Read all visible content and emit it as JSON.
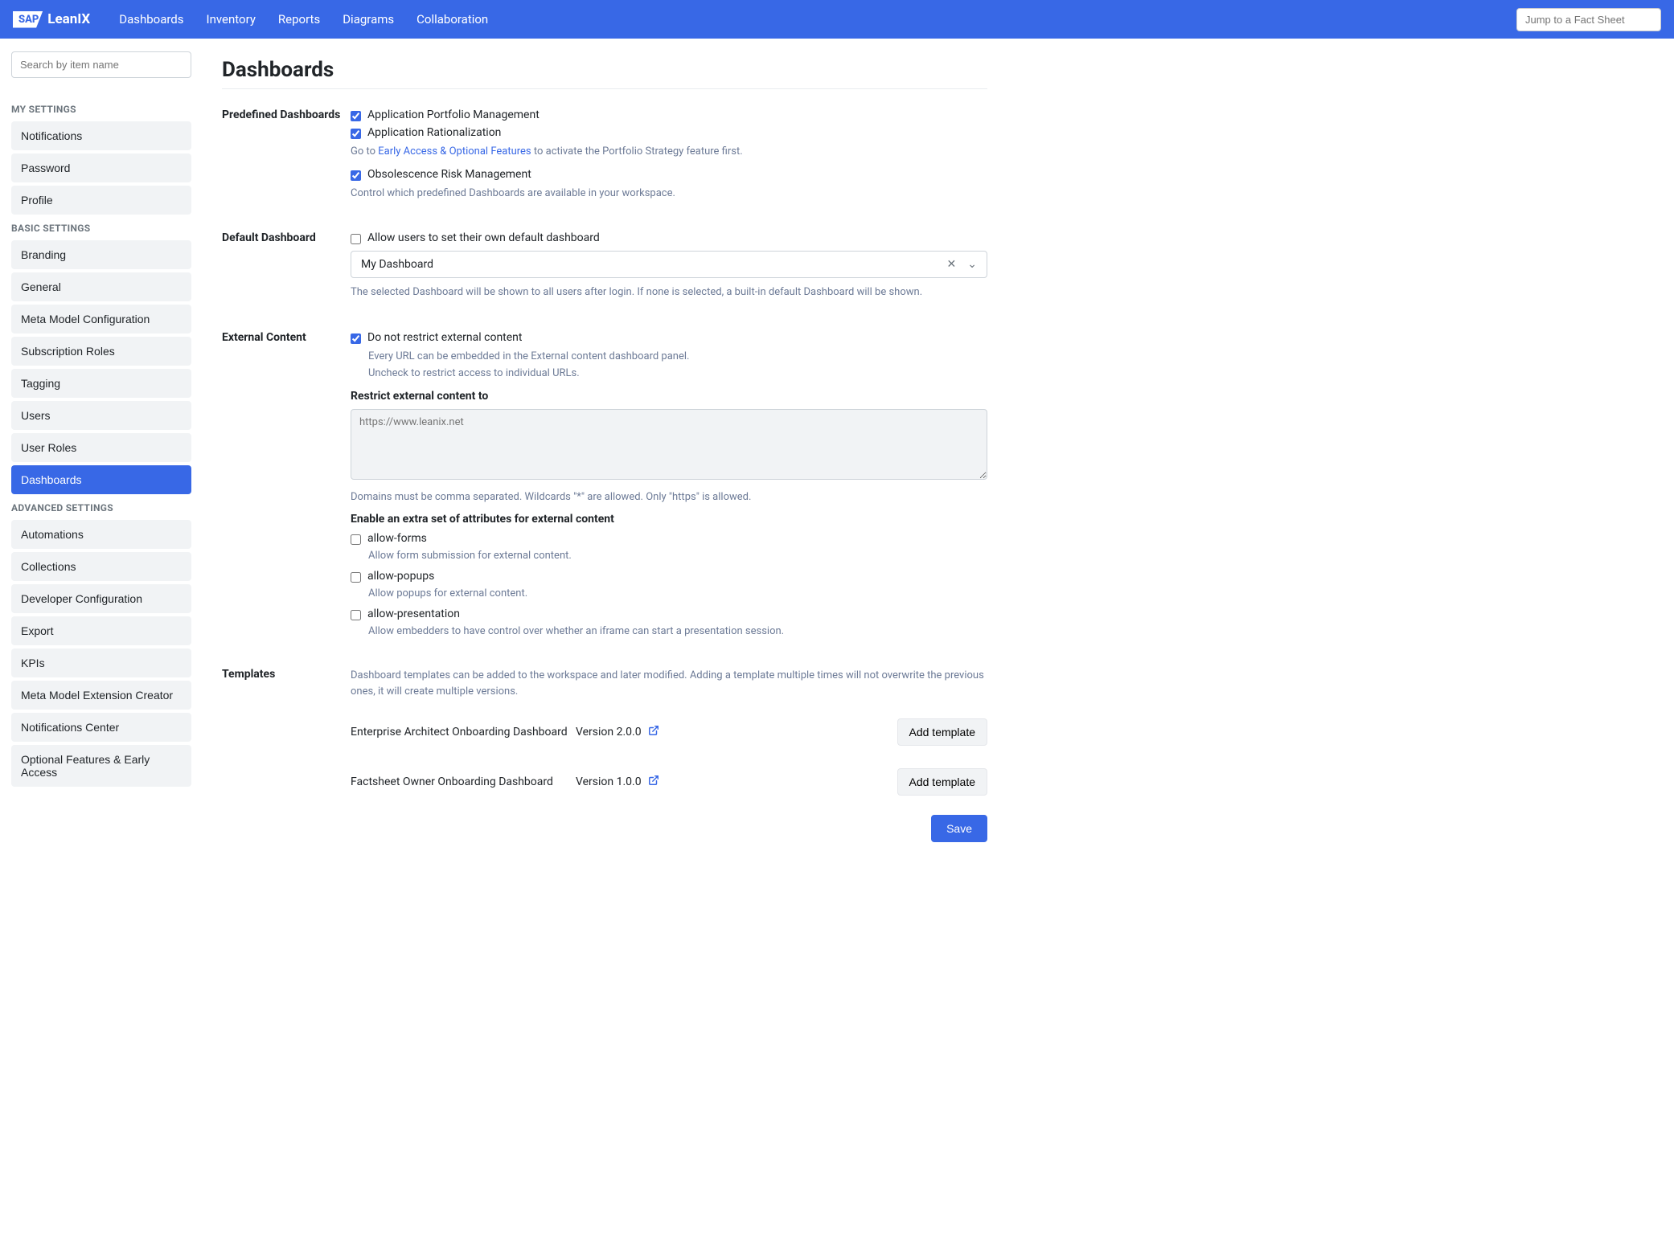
{
  "topnav": {
    "brand_sap": "SAP",
    "brand_product": "LeanIX",
    "links": [
      "Dashboards",
      "Inventory",
      "Reports",
      "Diagrams",
      "Collaboration"
    ],
    "jump_placeholder": "Jump to a Fact Sheet"
  },
  "sidebar": {
    "search_placeholder": "Search by item name",
    "groups": [
      {
        "heading": "MY SETTINGS",
        "items": [
          "Notifications",
          "Password",
          "Profile"
        ]
      },
      {
        "heading": "BASIC SETTINGS",
        "items": [
          "Branding",
          "General",
          "Meta Model Configuration",
          "Subscription Roles",
          "Tagging",
          "Users",
          "User Roles",
          "Dashboards"
        ]
      },
      {
        "heading": "ADVANCED SETTINGS",
        "items": [
          "Automations",
          "Collections",
          "Developer Configuration",
          "Export",
          "KPIs",
          "Meta Model Extension Creator",
          "Notifications Center",
          "Optional Features & Early Access"
        ]
      }
    ],
    "active": "Dashboards"
  },
  "page": {
    "title": "Dashboards"
  },
  "sections": {
    "predefined": {
      "label": "Predefined Dashboards",
      "items": [
        {
          "label": "Application Portfolio Management",
          "checked": true
        },
        {
          "label": "Application Rationalization",
          "checked": true
        }
      ],
      "portfolio_note_prefix": "Go to ",
      "portfolio_note_link": "Early Access & Optional Features",
      "portfolio_note_suffix": " to activate the Portfolio Strategy feature first.",
      "obsolescence": {
        "label": "Obsolescence Risk Management",
        "checked": true
      },
      "footer": "Control which predefined Dashboards are available in your workspace."
    },
    "default_dash": {
      "label": "Default Dashboard",
      "allow_label": "Allow users to set their own default dashboard",
      "allow_checked": false,
      "selected": "My Dashboard",
      "note": "The selected Dashboard will be shown to all users after login. If none is selected, a built-in default Dashboard will be shown."
    },
    "external": {
      "label": "External Content",
      "dont_restrict_label": "Do not restrict external content",
      "dont_restrict_checked": true,
      "note1": "Every URL can be embedded in the External content dashboard panel.",
      "note2": "Uncheck to restrict access to individual URLs.",
      "restrict_heading": "Restrict external content to",
      "restrict_placeholder": "https://www.leanix.net",
      "domains_note": "Domains must be comma separated. Wildcards \"*\" are allowed. Only \"https\" is allowed.",
      "attrs_heading": "Enable an extra set of attributes for external content",
      "attrs": [
        {
          "name": "allow-forms",
          "desc": "Allow form submission for external content.",
          "checked": false
        },
        {
          "name": "allow-popups",
          "desc": "Allow popups for external content.",
          "checked": false
        },
        {
          "name": "allow-presentation",
          "desc": "Allow embedders to have control over whether an iframe can start a presentation session.",
          "checked": false
        }
      ]
    },
    "templates": {
      "label": "Templates",
      "intro": "Dashboard templates can be added to the workspace and later modified. Adding a template multiple times will not overwrite the previous ones, it will create multiple versions.",
      "items": [
        {
          "name": "Enterprise Architect Onboarding Dashboard",
          "version": "Version 2.0.0"
        },
        {
          "name": "Factsheet Owner Onboarding Dashboard",
          "version": "Version 1.0.0"
        }
      ],
      "add_btn": "Add template"
    }
  },
  "actions": {
    "save": "Save"
  }
}
